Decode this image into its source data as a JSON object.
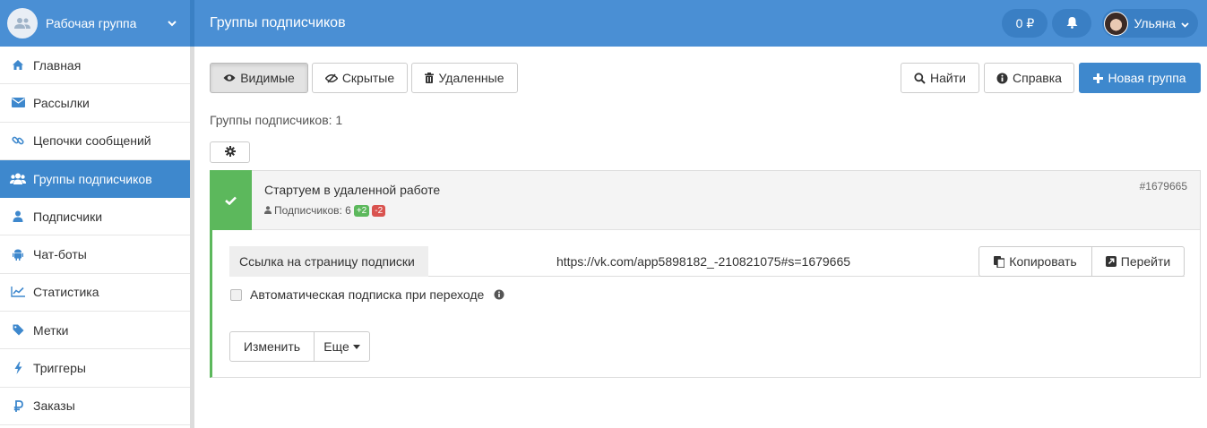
{
  "sidebar": {
    "workgroup": "Рабочая группа",
    "items": [
      {
        "label": "Главная",
        "icon": "home-icon"
      },
      {
        "label": "Рассылки",
        "icon": "envelope-icon"
      },
      {
        "label": "Цепочки сообщений",
        "icon": "link-icon"
      },
      {
        "label": "Группы подписчиков",
        "icon": "users-icon",
        "active": true
      },
      {
        "label": "Подписчики",
        "icon": "user-icon"
      },
      {
        "label": "Чат-боты",
        "icon": "android-icon"
      },
      {
        "label": "Статистика",
        "icon": "chart-icon"
      },
      {
        "label": "Метки",
        "icon": "tag-icon"
      },
      {
        "label": "Триггеры",
        "icon": "bolt-icon"
      },
      {
        "label": "Заказы",
        "icon": "ruble-icon"
      }
    ]
  },
  "header": {
    "title": "Группы подписчиков",
    "balance": "0 ₽",
    "user_name": "Ульяна"
  },
  "toolbar": {
    "visible_label": "Видимые",
    "hidden_label": "Скрытые",
    "deleted_label": "Удаленные",
    "search_label": "Найти",
    "help_label": "Справка",
    "new_group_label": "Новая группа"
  },
  "groups_count_text": "Группы подписчиков: 1",
  "group": {
    "title": "Стартуем в удаленной работе",
    "subscribers_text": "Подписчиков: 6",
    "plus_badge": "+2",
    "minus_badge": "-2",
    "id": "#1679665",
    "link_label": "Ссылка на страницу подписки",
    "link_url": "https://vk.com/app5898182_-210821075#s=1679665",
    "copy_label": "Копировать",
    "go_label": "Перейти",
    "auto_subscribe_label": "Автоматическая подписка при переходе",
    "edit_label": "Изменить",
    "more_label": "Еще"
  },
  "colors": {
    "primary": "#4a8fd4",
    "active_nav": "#3e88cd",
    "success": "#5cb85c",
    "danger": "#d9534f"
  }
}
